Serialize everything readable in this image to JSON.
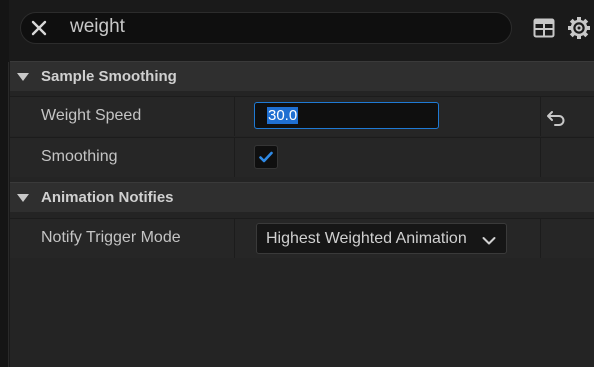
{
  "search": {
    "value": "weight",
    "clear_icon": "close-icon"
  },
  "toolbar": {
    "table_icon": "table-view-icon",
    "settings_icon": "gear-icon"
  },
  "categories": [
    {
      "label": "Sample Smoothing",
      "properties": [
        {
          "name": "Weight Speed",
          "value": "30.0",
          "type": "number",
          "reset_icon": "reset-arrow-icon"
        },
        {
          "name": "Smoothing",
          "checked": true,
          "type": "checkbox"
        }
      ]
    },
    {
      "label": "Animation Notifies",
      "properties": [
        {
          "name": "Notify Trigger Mode",
          "value": "Highest Weighted Animation",
          "type": "dropdown"
        }
      ]
    }
  ],
  "colors": {
    "accent": "#1f7ad4",
    "panel_bg": "#242424",
    "category_bg": "#2f2f2f"
  }
}
